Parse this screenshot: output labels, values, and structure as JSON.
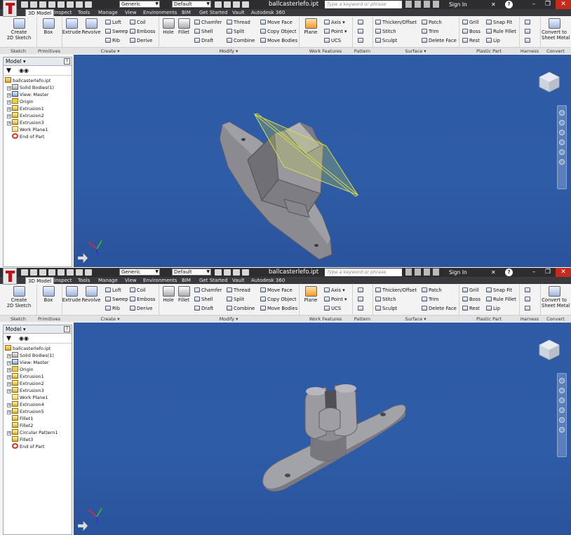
{
  "app": {
    "title": "ballcasterlefo.ipt",
    "material": "Generic",
    "appearance": "Default",
    "search_placeholder": "Type a keyword or phrase",
    "sign_in": "Sign In",
    "help": "?"
  },
  "tabs": [
    "3D Model",
    "Inspect",
    "Tools",
    "Manage",
    "View",
    "Environments",
    "BIM",
    "Get Started",
    "Vault",
    "Autodesk 360"
  ],
  "ribbon": {
    "sketch": {
      "create_2d_sketch": "Create\n2D Sketch",
      "label": "Sketch"
    },
    "primitives": {
      "box": "Box",
      "label": "Primitives"
    },
    "create": {
      "extrude": "Extrude",
      "revolve": "Revolve",
      "loft": "Loft",
      "sweep": "Sweep",
      "rib": "Rib",
      "coil": "Coil",
      "emboss": "Emboss",
      "derive": "Derive",
      "label": "Create"
    },
    "modify": {
      "hole": "Hole",
      "fillet": "Fillet",
      "chamfer": "Chamfer",
      "shell": "Shell",
      "draft": "Draft",
      "thread": "Thread",
      "split": "Split",
      "combine": "Combine",
      "move_face": "Move Face",
      "copy_object": "Copy Object",
      "move_bodies": "Move Bodies",
      "label": "Modify"
    },
    "work_features": {
      "plane": "Plane",
      "axis": "Axis",
      "point": "Point",
      "ucs": "UCS",
      "label": "Work Features"
    },
    "pattern": {
      "label": "Pattern"
    },
    "surface": {
      "thicken_offset": "Thicken/Offset",
      "stitch": "Stitch",
      "sculpt": "Sculpt",
      "patch": "Patch",
      "trim": "Trim",
      "delete_face": "Delete Face",
      "label": "Surface"
    },
    "plastic_part": {
      "grill": "Grill",
      "boss": "Boss",
      "rest": "Rest",
      "snap_fit": "Snap Fit",
      "rule_fillet": "Rule Fillet",
      "lip": "Lip",
      "label": "Plastic Part"
    },
    "harness": {
      "label": "Harness"
    },
    "convert": {
      "convert_to_sheet_metal": "Convert to\nSheet Metal",
      "label": "Convert"
    }
  },
  "browser": {
    "title": "Model",
    "help": "?"
  },
  "tree1": [
    {
      "label": "ballcasterlefo.ipt",
      "icon": "file",
      "indent": 0,
      "pm": ""
    },
    {
      "label": "Solid Bodies(1)",
      "icon": "body",
      "indent": 1,
      "pm": "+"
    },
    {
      "label": "View: Master",
      "icon": "view",
      "indent": 1,
      "pm": "+"
    },
    {
      "label": "Origin",
      "icon": "fold",
      "indent": 1,
      "pm": "+"
    },
    {
      "label": "Extrusion1",
      "icon": "feat",
      "indent": 1,
      "pm": "+"
    },
    {
      "label": "Extrusion2",
      "icon": "feat",
      "indent": 1,
      "pm": "+"
    },
    {
      "label": "Extrusion3",
      "icon": "feat",
      "indent": 1,
      "pm": "+"
    },
    {
      "label": "Work Plane1",
      "icon": "plane",
      "indent": 1,
      "pm": ""
    },
    {
      "label": "End of Part",
      "icon": "eop",
      "indent": 1,
      "pm": ""
    }
  ],
  "tree2": [
    {
      "label": "ballcasterlefo.ipt",
      "icon": "file",
      "indent": 0,
      "pm": ""
    },
    {
      "label": "Solid Bodies(1)",
      "icon": "body",
      "indent": 1,
      "pm": "+"
    },
    {
      "label": "View: Master",
      "icon": "view",
      "indent": 1,
      "pm": "+"
    },
    {
      "label": "Origin",
      "icon": "fold",
      "indent": 1,
      "pm": "+"
    },
    {
      "label": "Extrusion1",
      "icon": "feat",
      "indent": 1,
      "pm": "+"
    },
    {
      "label": "Extrusion2",
      "icon": "feat",
      "indent": 1,
      "pm": "+"
    },
    {
      "label": "Extrusion3",
      "icon": "feat",
      "indent": 1,
      "pm": "+"
    },
    {
      "label": "Work Plane1",
      "icon": "plane",
      "indent": 1,
      "pm": ""
    },
    {
      "label": "Extrusion4",
      "icon": "feat",
      "indent": 1,
      "pm": "+"
    },
    {
      "label": "Extrusion5",
      "icon": "feat",
      "indent": 1,
      "pm": "+"
    },
    {
      "label": "Fillet1",
      "icon": "feat",
      "indent": 1,
      "pm": ""
    },
    {
      "label": "Fillet2",
      "icon": "feat",
      "indent": 1,
      "pm": ""
    },
    {
      "label": "Circular Pattern1",
      "icon": "feat",
      "indent": 1,
      "pm": "+"
    },
    {
      "label": "Fillet3",
      "icon": "feat",
      "indent": 1,
      "pm": ""
    },
    {
      "label": "End of Part",
      "icon": "eop",
      "indent": 1,
      "pm": ""
    }
  ],
  "colors": {
    "viewport": "#2f5ca7",
    "model": "#8d8d92",
    "work_plane": "#d6e04a",
    "title_bar": "#2d2d30"
  }
}
